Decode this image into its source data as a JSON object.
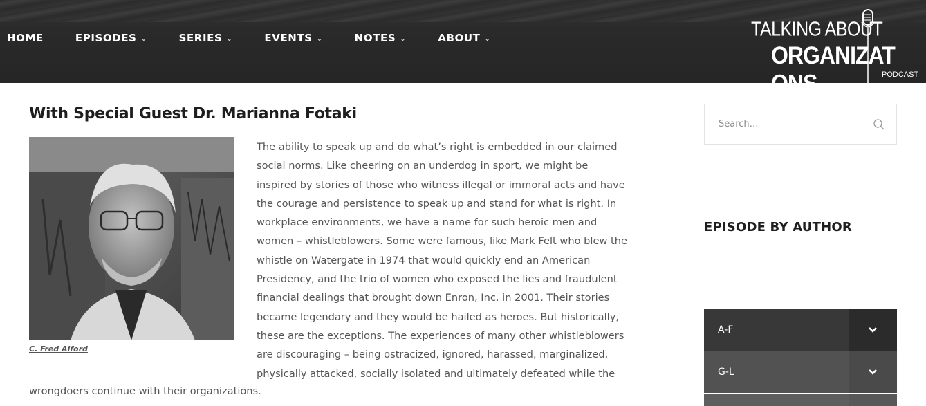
{
  "nav": {
    "items": [
      {
        "label": "HOME",
        "has_dropdown": false
      },
      {
        "label": "EPISODES",
        "has_dropdown": true
      },
      {
        "label": "SERIES",
        "has_dropdown": true
      },
      {
        "label": "EVENTS",
        "has_dropdown": true
      },
      {
        "label": "NOTES",
        "has_dropdown": true
      },
      {
        "label": "ABOUT",
        "has_dropdown": true
      }
    ],
    "dropdown_icon": "chevron-down-icon"
  },
  "logo": {
    "line1": "TALKING ABOUT",
    "line2": "ORGANIZAT  ONS",
    "line3": "PODCAST",
    "icon": "microphone-icon"
  },
  "article": {
    "title": "With Special Guest Dr. Marianna Fotaki",
    "photo_caption": "C. Fred Alford",
    "body_lines": [
      "The ability to speak up and do what’s right is embedded in our claimed",
      "social norms. Like cheering on an underdog in sport, we might be",
      "inspired by stories of those who witness illegal or immoral acts and have",
      "the courage and persistence to speak up and stand for what is right. In",
      "workplace environments, we have a name for such heroic men and",
      "women – whistleblowers. Some were famous, like Mark Felt who blew the",
      "whistle on Watergate in 1974 that would quickly end an American",
      "Presidency, and the trio of women who exposed the lies and fraudulent",
      "financial dealings that brought down Enron, Inc. in 2001. Their stories",
      "became legendary and they would be hailed as heroes. But historically,",
      "these are the exceptions. The experiences of many other whistleblowers",
      "are discouraging – being ostracized, ignored, harassed, marginalized,",
      "physically attacked, socially isolated and ultimately defeated while the"
    ],
    "last_line": "wrongdoers continue with their organizations."
  },
  "sidebar": {
    "search_placeholder": "Search…",
    "widget_title": "EPISODE BY AUTHOR",
    "accordion": [
      {
        "label": "A-F"
      },
      {
        "label": "G-L"
      },
      {
        "label": ""
      }
    ]
  },
  "colors": {
    "header_bg": "#262626",
    "accordion_dark": "#383838",
    "accordion_mid": "#525252",
    "text_body": "#555555",
    "title": "#1e1e1e"
  }
}
